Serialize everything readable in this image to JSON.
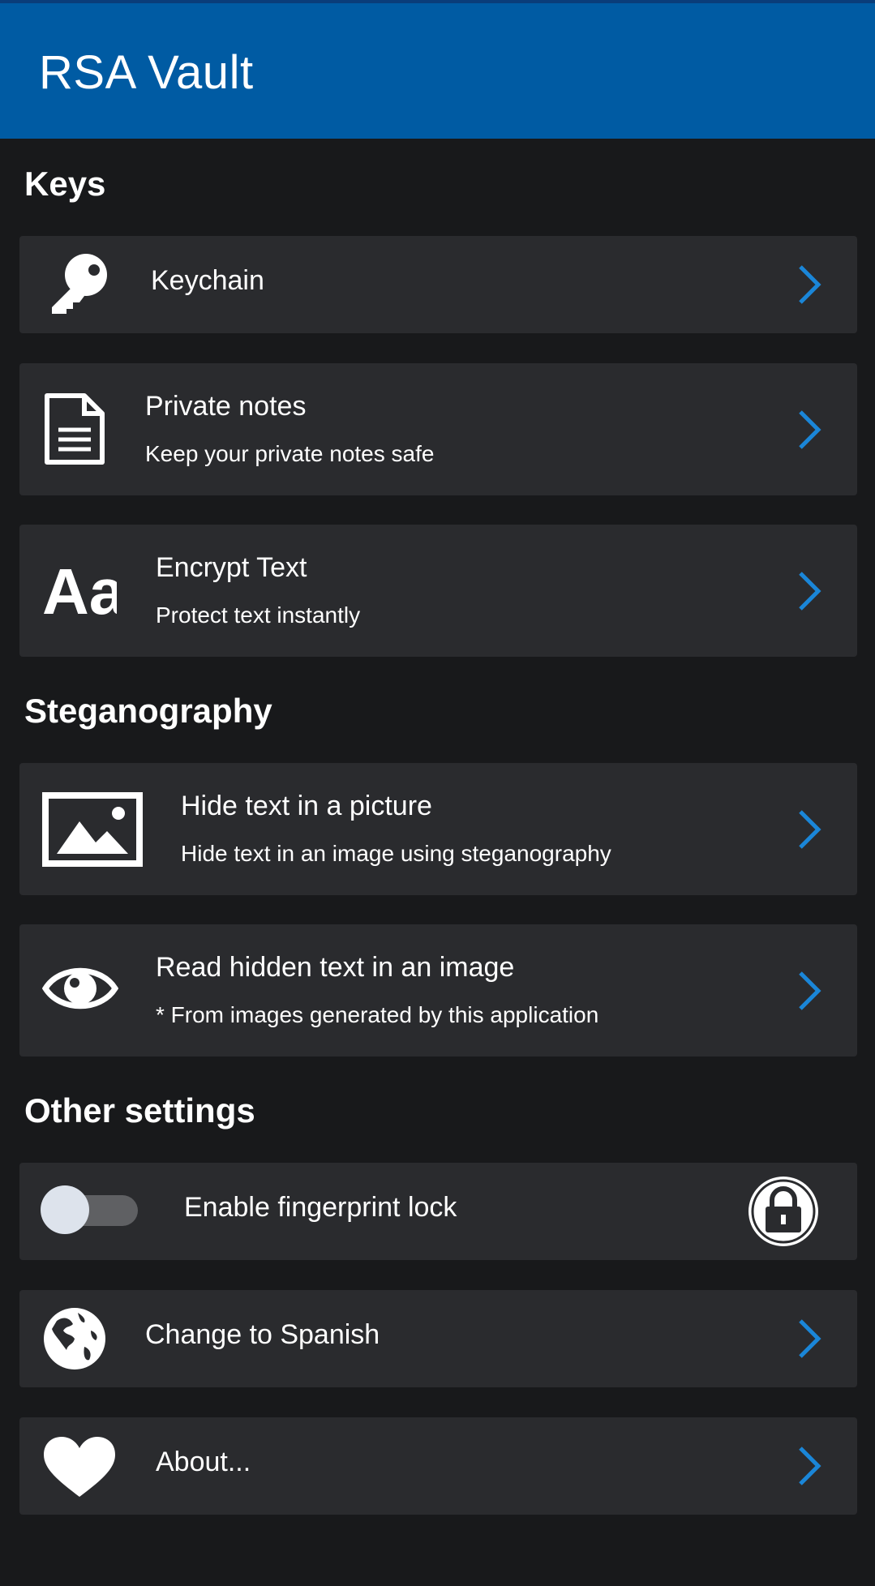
{
  "app": {
    "title": "RSA Vault"
  },
  "sections": {
    "keys": "Keys",
    "steganography": "Steganography",
    "other": "Other settings"
  },
  "items": {
    "keychain": {
      "title": "Keychain",
      "icon": "key-icon"
    },
    "private_notes": {
      "title": "Private notes",
      "subtitle": "Keep your private notes safe",
      "icon": "document-icon"
    },
    "encrypt_text": {
      "title": "Encrypt Text",
      "subtitle": "Protect text instantly",
      "icon": "text-format-icon"
    },
    "hide_text": {
      "title": "Hide text in a picture",
      "subtitle": "Hide text in an image using steganography",
      "icon": "image-icon"
    },
    "read_hidden": {
      "title": "Read hidden text in an image",
      "subtitle": "* From images generated by this application",
      "icon": "eye-icon"
    },
    "fingerprint": {
      "title": "Enable fingerprint lock",
      "enabled": false,
      "icon": "lock-icon"
    },
    "spanish": {
      "title": "Change to Spanish",
      "icon": "globe-icon"
    },
    "about": {
      "title": "About...",
      "icon": "heart-icon"
    }
  },
  "colors": {
    "header": "#005ba3",
    "background": "#18191b",
    "card": "#2a2b2e",
    "chevron": "#1a86d8"
  }
}
